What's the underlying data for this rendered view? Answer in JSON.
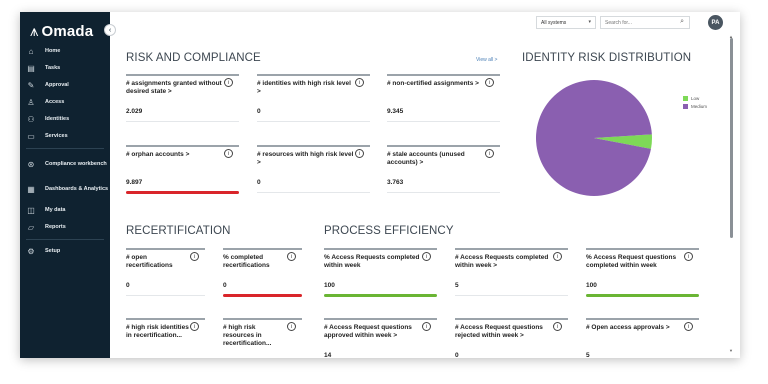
{
  "app": {
    "logo_mark": "⩚",
    "logo_text": "Omada",
    "collapse_glyph": "‹"
  },
  "sidebar": {
    "items": [
      {
        "label": "Home",
        "icon": "home-icon",
        "glyph": "⌂"
      },
      {
        "label": "Tasks",
        "icon": "tasks-icon",
        "glyph": "▤"
      },
      {
        "label": "Approval",
        "icon": "approval-icon",
        "glyph": "✎"
      },
      {
        "label": "Access",
        "icon": "access-icon",
        "glyph": "♙"
      },
      {
        "label": "Identities",
        "icon": "identities-icon",
        "glyph": "⚇"
      },
      {
        "label": "Services",
        "icon": "services-icon",
        "glyph": "▭"
      },
      {
        "label": "Compliance workbench",
        "icon": "compliance-icon",
        "glyph": "⊛"
      },
      {
        "label": "Dashboards & Analytics",
        "icon": "dashboards-icon",
        "glyph": "▦"
      },
      {
        "label": "My data",
        "icon": "my-data-icon",
        "glyph": "◫"
      },
      {
        "label": "Reports",
        "icon": "reports-icon",
        "glyph": "▱"
      },
      {
        "label": "Setup",
        "icon": "setup-icon",
        "glyph": "⚙"
      }
    ]
  },
  "topbar": {
    "system_select": "All systems",
    "search_placeholder": "Search for...",
    "avatar_initials": "PA"
  },
  "risk": {
    "title": "RISK AND COMPLIANCE",
    "view_all": "View all >",
    "cards": [
      {
        "title": "# assignments granted without desired state >",
        "value": "2.029",
        "bar": "none"
      },
      {
        "title": "# identities with high risk level >",
        "value": "0",
        "bar": "none"
      },
      {
        "title": "# non-certified assignments >",
        "value": "9.345",
        "bar": "none"
      },
      {
        "title": "# orphan accounts >",
        "value": "9.897",
        "bar": "red"
      },
      {
        "title": "# resources with high risk level >",
        "value": "0",
        "bar": "none"
      },
      {
        "title": "# stale accounts (unused accounts) >",
        "value": "3.763",
        "bar": "none"
      }
    ]
  },
  "identity_risk": {
    "title": "IDENTITY RISK DISTRIBUTION",
    "legend": [
      {
        "label": "Low",
        "color": "#7ed957"
      },
      {
        "label": "Medium",
        "color": "#8a5fb0"
      }
    ]
  },
  "chart_data": {
    "type": "pie",
    "title": "IDENTITY RISK DISTRIBUTION",
    "slices": [
      {
        "label": "Low",
        "value": 4,
        "color": "#7ed957"
      },
      {
        "label": "Medium",
        "value": 96,
        "color": "#8a5fb0"
      }
    ],
    "legend_position": "top-right"
  },
  "recert": {
    "title": "RECERTIFICATION",
    "cards": [
      {
        "title": "# open recertifications",
        "value": "0",
        "bar": "none"
      },
      {
        "title": "% completed recertifications",
        "value": "0",
        "bar": "red"
      },
      {
        "title": "# high risk identities in recertification...",
        "value": "",
        "bar": "none"
      },
      {
        "title": "# high risk resources in recertification...",
        "value": "",
        "bar": "none"
      }
    ]
  },
  "process": {
    "title": "PROCESS EFFICIENCY",
    "cards": [
      {
        "title": "% Access Requests completed within week",
        "value": "100",
        "bar": "green"
      },
      {
        "title": "# Access Requests completed within week >",
        "value": "5",
        "bar": "none"
      },
      {
        "title": "% Access Request questions completed within week",
        "value": "100",
        "bar": "green"
      },
      {
        "title": "# Access Request questions approved within week >",
        "value": "14",
        "bar": "none"
      },
      {
        "title": "# Access Request questions rejected within week >",
        "value": "0",
        "bar": "none"
      },
      {
        "title": "# Open access approvals >",
        "value": "5",
        "bar": "none"
      }
    ]
  },
  "info_glyph": "i"
}
